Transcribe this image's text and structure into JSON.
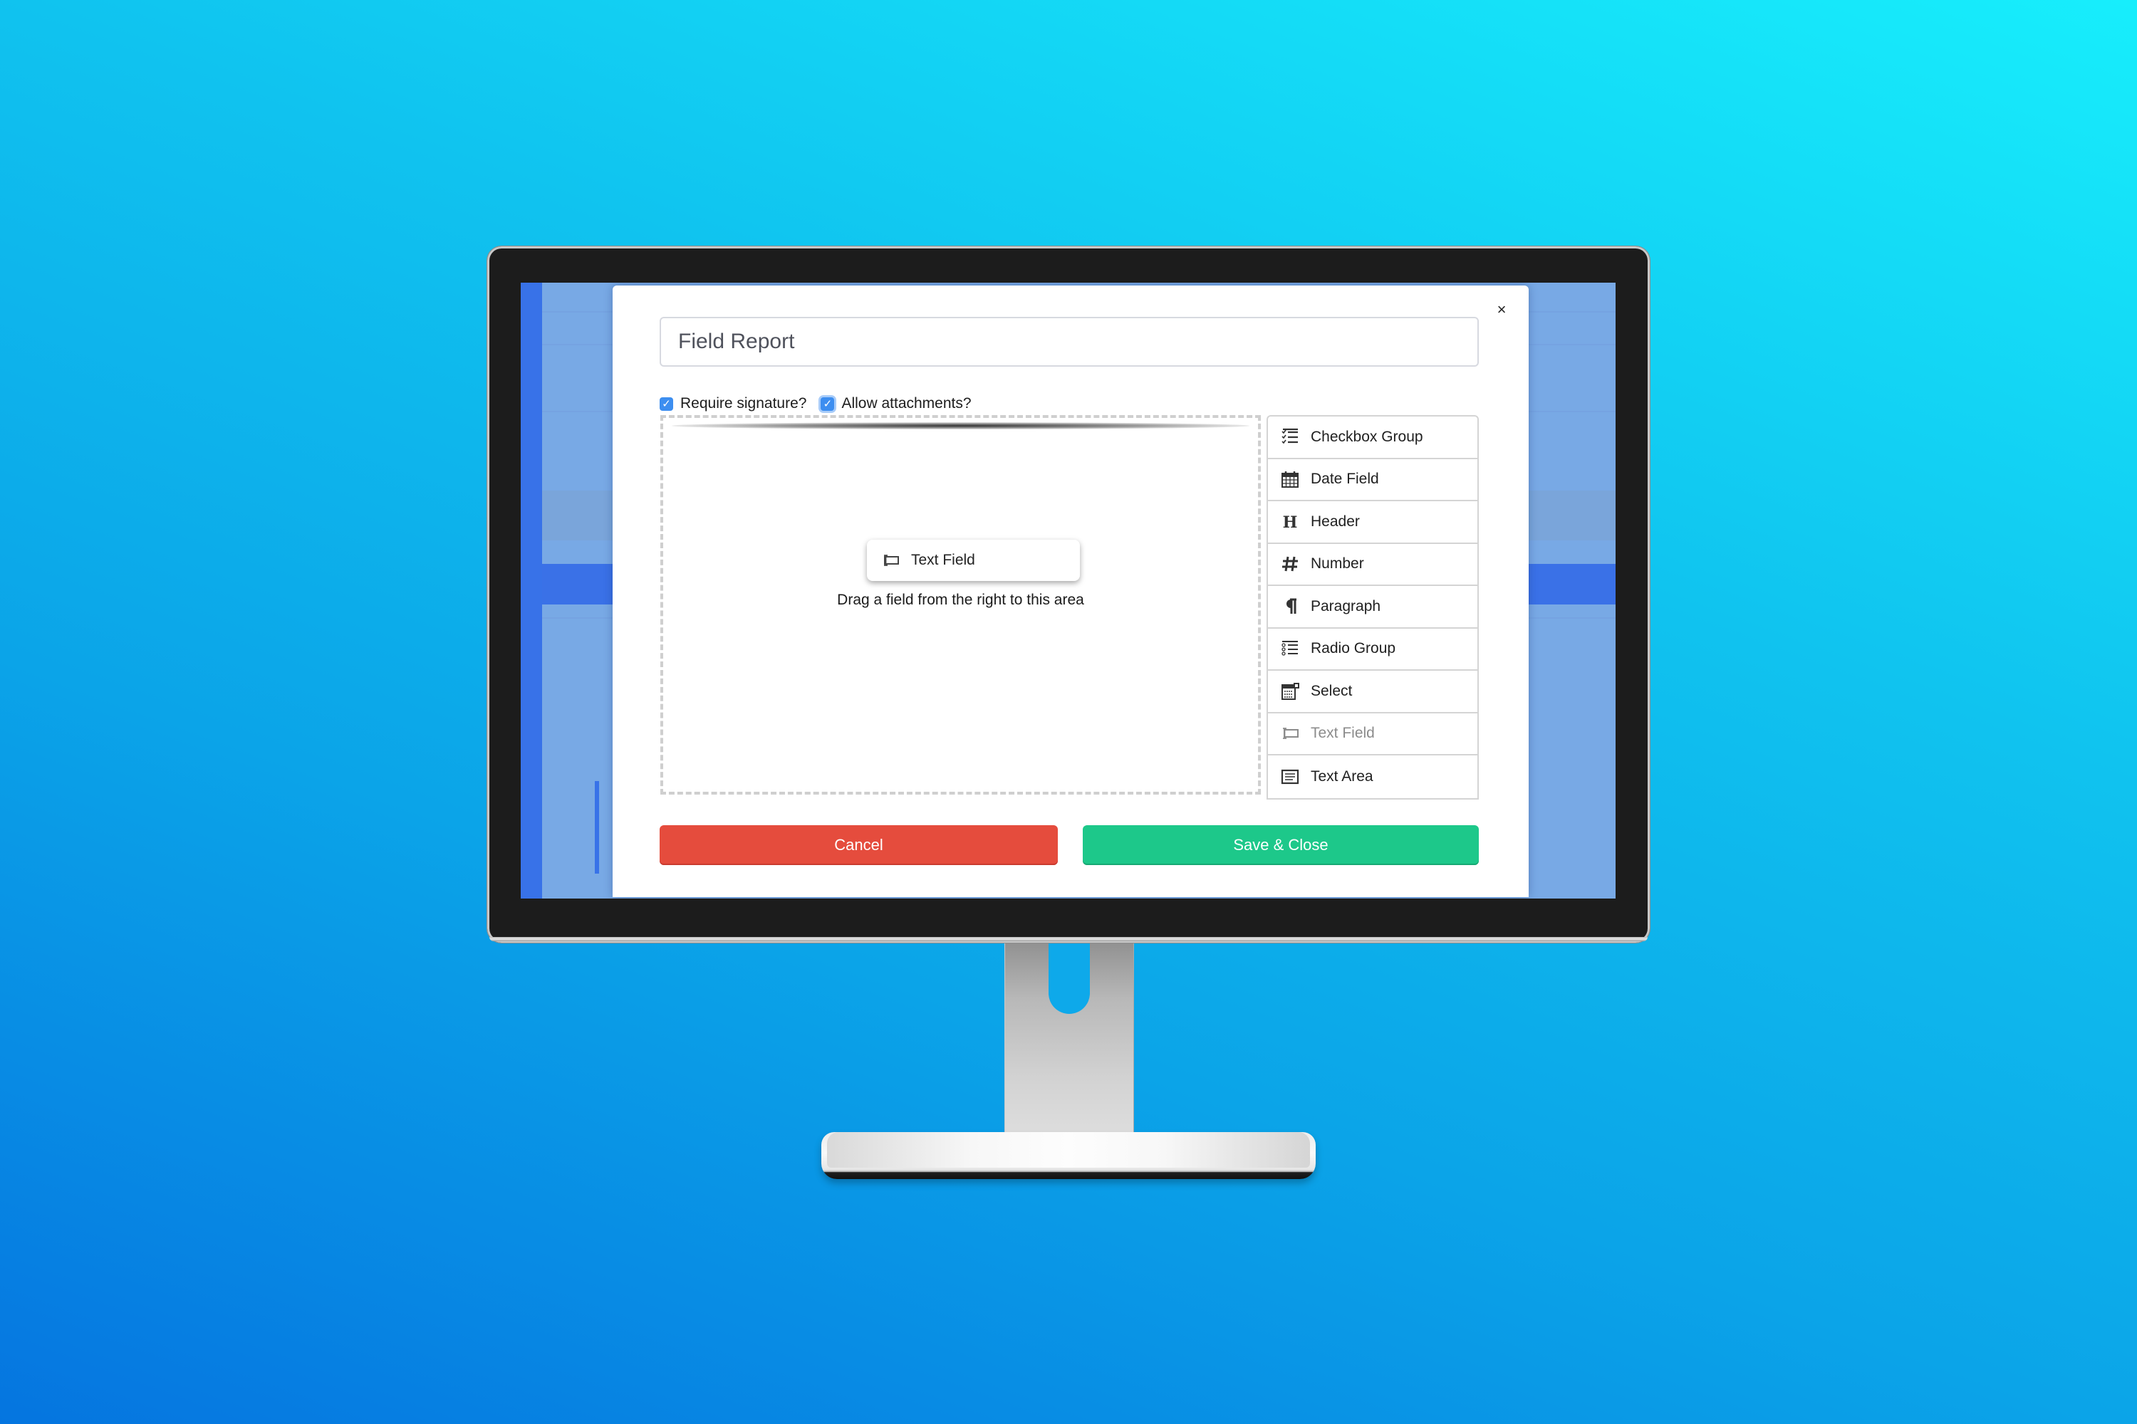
{
  "colors": {
    "cancel": "#e54c3d",
    "save": "#1dc88a",
    "checkbox": "#3d8ef0",
    "screen_background": "#7dafec",
    "screen_accent": "#3874ef"
  },
  "modal": {
    "close_label": "×",
    "title_input": {
      "value": "Field Report",
      "placeholder": ""
    },
    "options": [
      {
        "label": "Require signature?",
        "checked": true
      },
      {
        "label": "Allow attachments?",
        "checked": true
      }
    ],
    "drop_area": {
      "hint": "Drag a field from the right to this area",
      "dragging_item": {
        "label": "Text Field",
        "icon": "text-field-icon"
      }
    },
    "field_types": [
      {
        "label": "Checkbox Group",
        "icon": "checkbox-group-icon",
        "disabled": false
      },
      {
        "label": "Date Field",
        "icon": "calendar-icon",
        "disabled": false
      },
      {
        "label": "Header",
        "icon": "header-icon",
        "disabled": false
      },
      {
        "label": "Number",
        "icon": "hash-icon",
        "disabled": false
      },
      {
        "label": "Paragraph",
        "icon": "paragraph-icon",
        "disabled": false
      },
      {
        "label": "Radio Group",
        "icon": "radio-group-icon",
        "disabled": false
      },
      {
        "label": "Select",
        "icon": "select-icon",
        "disabled": false
      },
      {
        "label": "Text Field",
        "icon": "text-field-icon",
        "disabled": true
      },
      {
        "label": "Text Area",
        "icon": "text-area-icon",
        "disabled": false
      }
    ],
    "buttons": {
      "cancel": "Cancel",
      "save": "Save & Close"
    }
  }
}
